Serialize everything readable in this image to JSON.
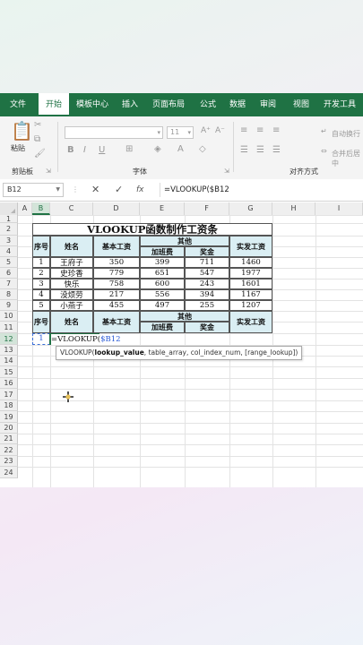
{
  "tabs": [
    "文件",
    "开始",
    "模板中心",
    "插入",
    "页面布局",
    "公式",
    "数据",
    "审阅",
    "视图",
    "开发工具"
  ],
  "active_tab": "开始",
  "ribbon": {
    "clipboard_label": "剪贴板",
    "paste_label": "粘贴",
    "font_label": "字体",
    "font_size": "11",
    "bold": "B",
    "italic": "I",
    "underline": "U",
    "grow_font": "A⁺",
    "shrink_font": "A⁻",
    "align_label": "对齐方式",
    "wrap_text": "自动换行",
    "merge_center": "合并后居中"
  },
  "formula_bar": {
    "name_box": "B12",
    "cancel": "✕",
    "enter": "✓",
    "fx": "fx",
    "formula": "=VLOOKUP($B12"
  },
  "columns": [
    "A",
    "B",
    "C",
    "D",
    "E",
    "F",
    "G",
    "H",
    "I"
  ],
  "selected_column": "B",
  "rows": [
    "1",
    "2",
    "3",
    "4",
    "5",
    "6",
    "7",
    "8",
    "9",
    "10",
    "11",
    "12",
    "13",
    "14",
    "15",
    "16",
    "17",
    "18",
    "19",
    "20",
    "21",
    "22",
    "23",
    "24"
  ],
  "selected_row": "12",
  "table": {
    "title": "VLOOKUP函数制作工资条",
    "headers": {
      "seq": "序号",
      "name": "姓名",
      "base": "基本工资",
      "other": "其他",
      "overtime": "加班费",
      "bonus": "奖金",
      "net": "实发工资"
    },
    "records": [
      [
        "1",
        "王府子",
        "350",
        "399",
        "711",
        "1460"
      ],
      [
        "2",
        "史珍香",
        "779",
        "651",
        "547",
        "1977"
      ],
      [
        "3",
        "快乐",
        "758",
        "600",
        "243",
        "1601"
      ],
      [
        "4",
        "没烦劳",
        "217",
        "556",
        "394",
        "1167"
      ],
      [
        "5",
        "小燕子",
        "455",
        "497",
        "255",
        "1207"
      ]
    ]
  },
  "slip": {
    "headers": {
      "seq": "序号",
      "name": "姓名",
      "base": "基本工资",
      "other": "其他",
      "overtime": "加班费",
      "bonus": "奖金",
      "net": "实发工资"
    },
    "seq_value": "1",
    "editor_prefix": "=VLOOKUP(",
    "editor_ref": "$B12"
  },
  "tooltip": {
    "fn": "VLOOKUP(",
    "arg1": "lookup_value",
    "rest": ", table_array, col_index_num, [range_lookup])"
  },
  "colors": {
    "accent": "#1f7244",
    "header_fill": "#daeef3"
  }
}
